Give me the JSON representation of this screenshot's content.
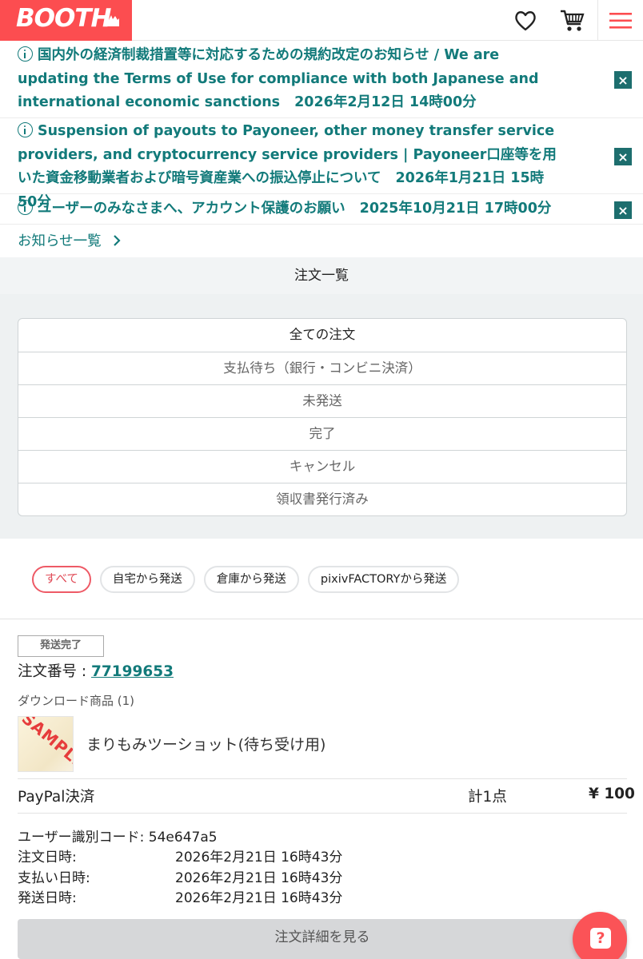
{
  "header": {
    "logo": "BOOTH",
    "icons": [
      "heart-icon",
      "cart-icon",
      "menu-icon"
    ],
    "brand_color": "#fc4d50"
  },
  "notices": [
    {
      "text": "国内外の経済制裁措置等に対応するための規約改定のお知らせ / We are updating the Terms of Use for compliance with both Japanese and international economic sanctions",
      "date": "2026年2月12日 14時00分"
    },
    {
      "text": "Suspension of payouts to Payoneer, other money transfer service providers, and cryptocurrency service providers | Payoneer口座等を用いた資金移動業者および暗号資産業への振込停止について",
      "date": "2026年1月21日 15時50分"
    },
    {
      "text": "ユーザーのみなさまへ、アカウント保護のお願い",
      "date": "2025年10月21日 17時00分"
    }
  ],
  "notice_list_link": "お知らせ一覧",
  "section_title": "注文一覧",
  "tabs": [
    "全ての注文",
    "支払待ち（銀行・コンビニ決済）",
    "未発送",
    "完了",
    "キャンセル",
    "領収書発行済み"
  ],
  "chips": [
    "すべて",
    "自宅から発送",
    "倉庫から発送",
    "pixivFACTORYから発送"
  ],
  "order": {
    "status": "発送完了",
    "number_label": "注文番号 : ",
    "number": "77199653",
    "download_label": "ダウンロード商品 (1)",
    "thumb_watermark": "SAMPLE",
    "item_name": "まりもみツーショット(待ち受け用)",
    "payment_method": "PayPal決済",
    "count": "計1点",
    "total": "¥ 100",
    "user_code": "ユーザー識別コード: 54e647a5",
    "order_date_label": "注文日時:",
    "order_date": "2026年2月21日 16時43分",
    "paid_date_label": "支払い日時:",
    "paid_date": "2026年2月21日 16時43分",
    "ship_date_label": "発送日時:",
    "ship_date": "2026年2月21日 16時43分",
    "detail_button": "注文詳細を見る"
  },
  "help_icon": "?"
}
